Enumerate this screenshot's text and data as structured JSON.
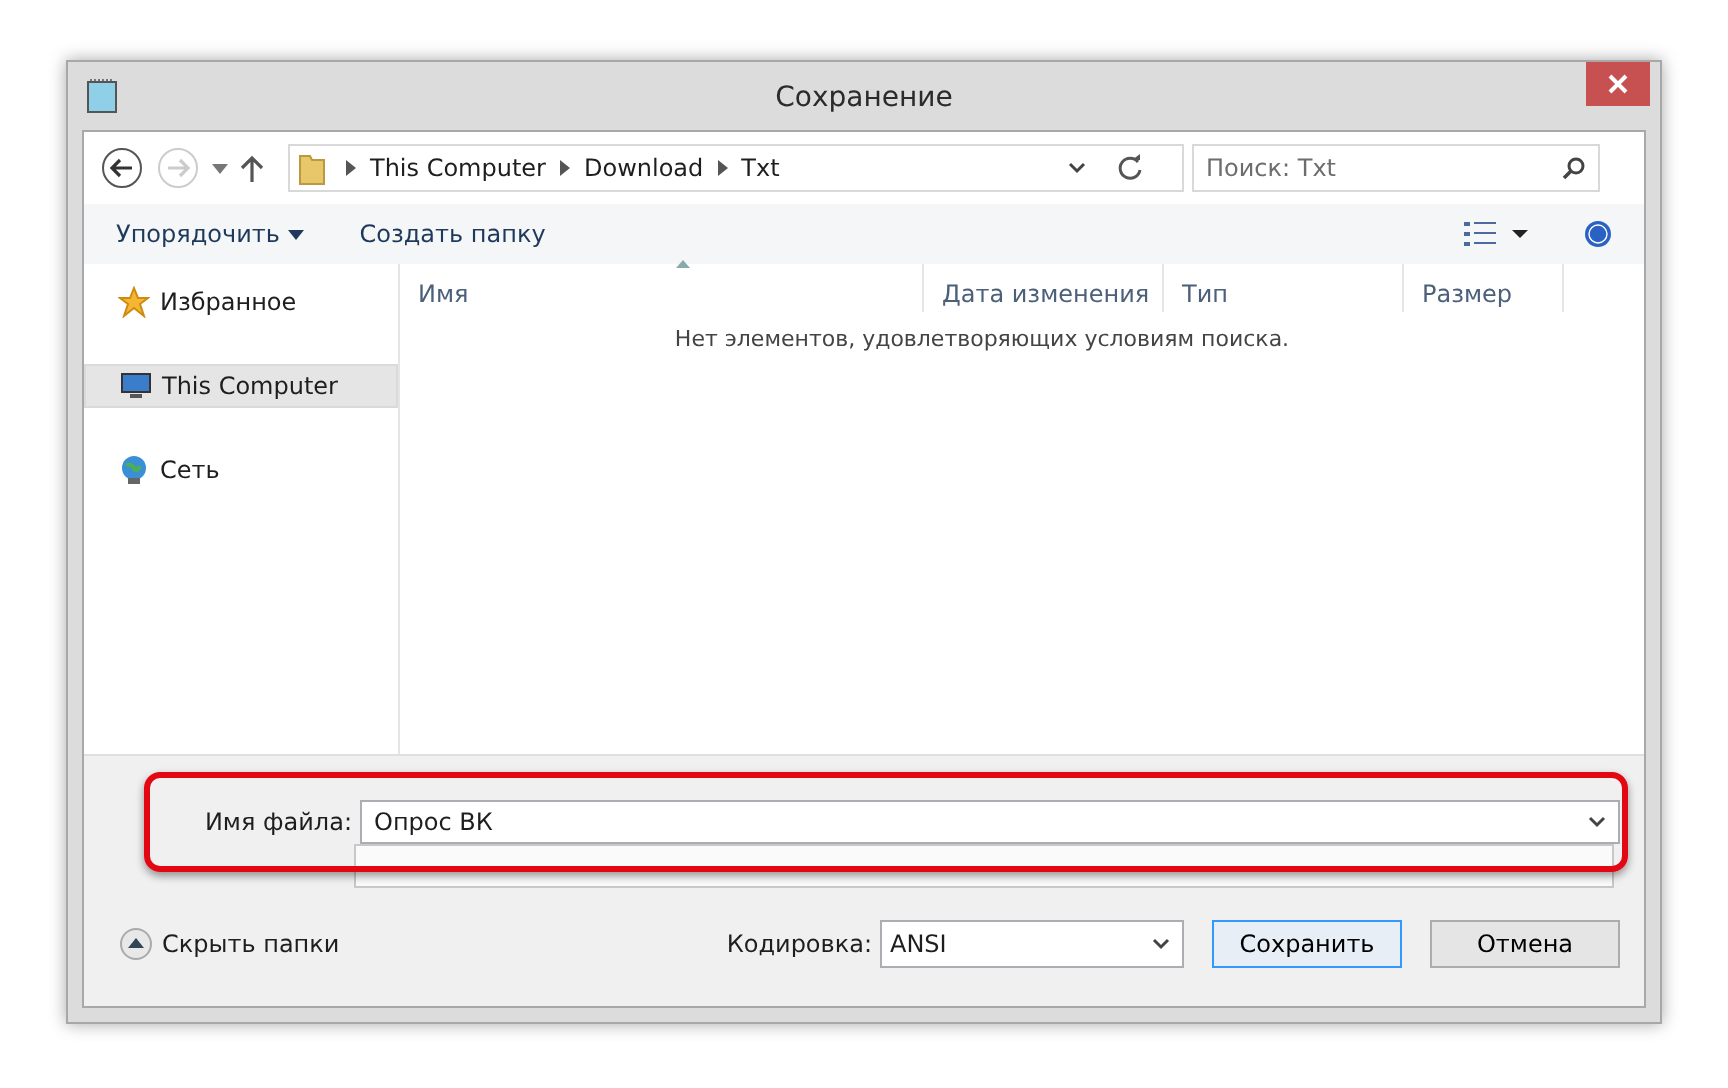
{
  "window": {
    "title": "Сохранение"
  },
  "breadcrumb": [
    "This Computer",
    "Download",
    "Txt"
  ],
  "search": {
    "placeholder": "Поиск: Txt"
  },
  "toolbar": {
    "organize": "Упорядочить",
    "new_folder": "Создать папку"
  },
  "sidebar": {
    "items": [
      {
        "label": "Избранное",
        "kind": "favorites",
        "selected": false
      },
      {
        "label": "This Computer",
        "kind": "computer",
        "selected": true
      },
      {
        "label": "Сеть",
        "kind": "network",
        "selected": false
      }
    ]
  },
  "table": {
    "columns": [
      "Имя",
      "Дата изменения",
      "Тип",
      "Размер"
    ],
    "empty_message": "Нет элементов, удовлетворяющих условиям поиска."
  },
  "file_name": {
    "label": "Имя файла:",
    "value": "Опрос ВК",
    "highlighted": true
  },
  "footer": {
    "hide_folders": "Скрыть папки",
    "encoding_label": "Кодировка:",
    "encoding": "ANSI",
    "buttons": [
      "Сохранить",
      "Отмена"
    ]
  }
}
